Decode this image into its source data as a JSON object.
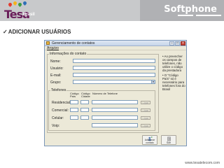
{
  "header": {
    "brand_title": "Softphone",
    "logo_text": "Tesa",
    "logo_sub": "Brasil"
  },
  "section_heading": "ADICIONAR USUÁRIOS",
  "window": {
    "title": "Gerenciamento de contatos",
    "menu": [
      "Arquivo"
    ],
    "info_legend": "Informações do contato",
    "fields": [
      {
        "label": "Nome:",
        "value": ""
      },
      {
        "label": "Usuário:",
        "value": ""
      },
      {
        "label": "E-mail:",
        "value": ""
      },
      {
        "label": "Grupo:",
        "value": ""
      }
    ],
    "tel_legend": "Telefones",
    "tel_headers": {
      "pais": "Código País",
      "cidade": "Código Cidade",
      "numero": "Número de Telefone"
    },
    "tel_rows": [
      {
        "label": "Residencial:",
        "button": "Ligar"
      },
      {
        "label": "Comercial:",
        "button": "Ligar"
      },
      {
        "label": "Celular:",
        "button": "Ligar"
      },
      {
        "label": "Voip:",
        "button": "Ligar"
      }
    ],
    "notes": [
      "• Ao preencher os campos de telefones, não utilize o código da prestadora",
      "• O \"Código País\" só é necessário para telefones fora do Brasil"
    ],
    "buttons": {
      "add": "Adicionar contato",
      "exit": "Sair"
    }
  },
  "footer_url": "www.tesatelecom.com"
}
